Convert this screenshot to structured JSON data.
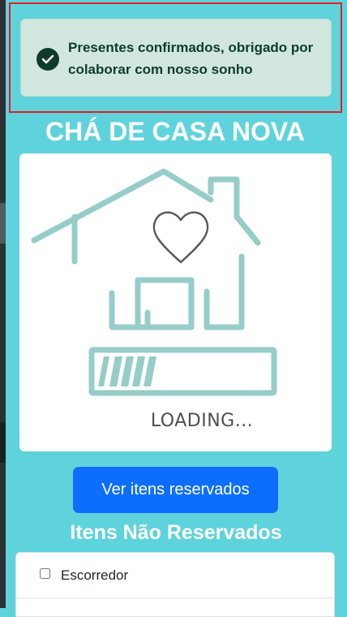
{
  "alert": {
    "message": "Presentes confirmados, obrigado por colaborar com nosso sonho",
    "status_color": "#0f3b2a",
    "background": "#d1e7dd"
  },
  "header": {
    "title": "CHÁ DE CASA NOVA"
  },
  "hero": {
    "icon": "house-heart-loading-illustration",
    "loading_text": "LOADING...",
    "accent": "#96cdc8",
    "loading_progress": 0.28
  },
  "actions": {
    "view_reserved_label": "Ver itens reservados",
    "button_color": "#0d6efd"
  },
  "unreserved": {
    "title": "Itens Não Reservados",
    "items": [
      {
        "label": "Escorredor",
        "checked": false
      }
    ]
  },
  "background_color": "#5fd3dc"
}
